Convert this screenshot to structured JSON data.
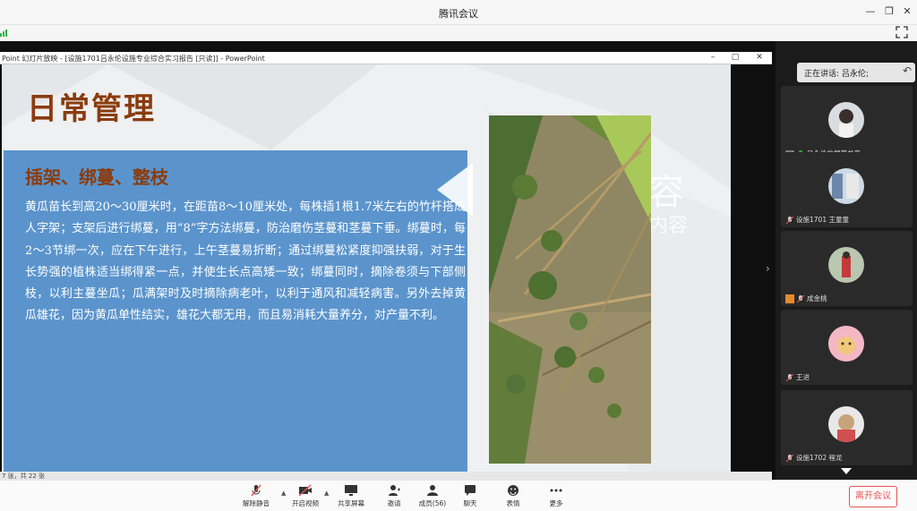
{
  "window": {
    "title": "腾讯会议"
  },
  "ppt": {
    "window_title": "Point 幻灯片放映 - [设施1701吕永伦设施专业综合实习报告 [只读]] - PowerPoint",
    "status_text": "7 张，共 22 张"
  },
  "slide": {
    "title": "日常管理",
    "subheading": "插架、绑蔓、整枝",
    "body": "黄瓜苗长到高20～30厘米时，在距苗8～10厘米处，每株插1根1.7米左右的竹杆搭成人字架；支架后进行绑蔓，用“8”字方法绑蔓，防治磨伤茎蔓和茎蔓下垂。绑蔓时，每2～3节绑一次，应在下午进行，上午茎蔓易折断；通过绑蔓松紧度抑强扶弱，对于生长势强的植株适当绑得紧一点，并使生长点高矮一致；绑蔓同时，摘除卷须与下部侧枝，以利主蔓坐瓜；瓜满架时及时摘除病老叶，以利于通风和减轻病害。另外去掉黄瓜雄花，因为黄瓜单性结实，雄花大都无用，而且易消耗大量养分，对产量不利。",
    "ghost_text_1": "容",
    "ghost_text_2": "内容"
  },
  "panel": {
    "speaking_label": "正在讲话: 吕永伦;",
    "participants": [
      {
        "name": "吕永伦的屏幕共享"
      },
      {
        "name": "设施1701 王童童"
      },
      {
        "name": "成金桃"
      },
      {
        "name": "王进"
      },
      {
        "name": "设施1702 程龙"
      }
    ]
  },
  "toolbar": {
    "mute": "解除静音",
    "video": "开启视频",
    "share": "共享屏幕",
    "invite": "邀请",
    "members": "成员(56)",
    "chat": "聊天",
    "reactions": "表情",
    "more": "更多",
    "leave": "离开会议"
  },
  "colors": {
    "slide_title": "#8b3b0d",
    "blue_box": "#5b94cc",
    "leave_red": "#e35555"
  }
}
